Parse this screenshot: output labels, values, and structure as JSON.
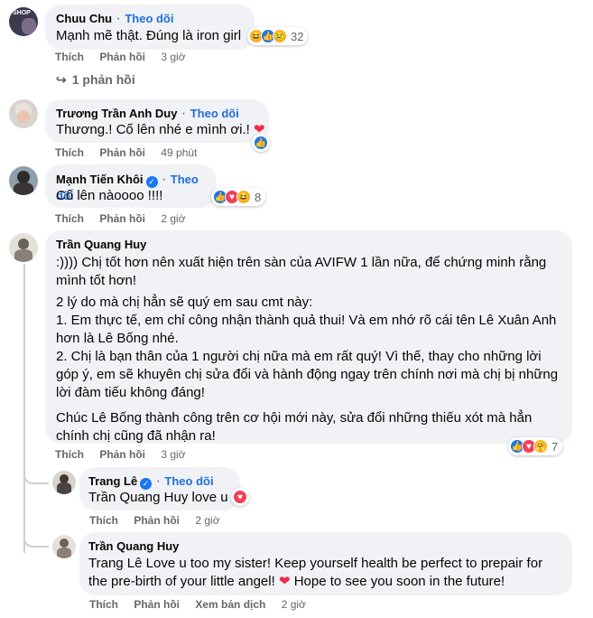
{
  "comments": [
    {
      "name": "Chuu Chu",
      "follow": "Theo dõi",
      "text": "Mạnh mẽ thật. Đúng là iron girl",
      "reactions": [
        "haha",
        "like",
        "sad"
      ],
      "reaction_count": "32",
      "like_label": "Thích",
      "reply_label": "Phản hồi",
      "time": "3 giờ",
      "replies_link": "1 phản hồi",
      "avatar_badge": "SHOP"
    },
    {
      "name": "Trương Trần Anh Duy",
      "follow": "Theo dõi",
      "text": "Thương.! Cố lên nhé e mình ơi.!",
      "reactions": [
        "like"
      ],
      "like_label": "Thích",
      "reply_label": "Phản hồi",
      "time": "49 phút"
    },
    {
      "name": "Mạnh Tiến Khôi",
      "follow": "Theo dõi",
      "text": "Cố lên nàoooo !!!!",
      "reactions": [
        "like",
        "love",
        "haha"
      ],
      "reaction_count": "8",
      "like_label": "Thích",
      "reply_label": "Phản hồi",
      "time": "2 giờ"
    },
    {
      "name": "Trần Quang Huy",
      "paragraphs": [
        ":)))) Chị tốt hơn nên xuất hiện trên sàn của AVIFW 1 lần nữa, để chứng minh rằng mình tốt hơn!",
        "2 lý do mà chị hẳn sẽ quý em sau cmt này:",
        "1. Em thực tế, em chỉ công nhận thành quả thui! Và em nhớ rõ cái tên Lê Xuân Anh hơn là Lê Bống nhé.",
        "2. Chị là bạn thân của 1 người chị nữa mà em rất quý! Vì thế, thay cho những lời góp ý, em sẽ khuyên chị sửa đổi và hành động ngay trên chính nơi mà chị bị những lời đàm tiếu không đáng!",
        "Chúc Lê Bống thành công trên cơ hội mới này, sửa đổi những thiếu xót mà hẳn chính chị cũng đã nhận ra!"
      ],
      "reactions": [
        "like",
        "love",
        "care"
      ],
      "reaction_count": "7",
      "like_label": "Thích",
      "reply_label": "Phản hồi",
      "time": "3 giờ"
    }
  ],
  "replies": [
    {
      "name": "Trang Lê",
      "follow": "Theo dõi",
      "mention": "Trần Quang Huy",
      "text": "love u",
      "reactions": [
        "love"
      ],
      "like_label": "Thích",
      "reply_label": "Phản hồi",
      "time": "2 giờ"
    },
    {
      "name": "Trần Quang Huy",
      "mention": "Trang Lê",
      "text": "Love u too my sister! Keep yourself health be perfect to prepair for the pre-birth of your little angel!",
      "text2": "Hope to see you soon in the future!",
      "like_label": "Thích",
      "reply_label": "Phản hồi",
      "translate_label": "Xem bản dịch",
      "time": "2 giờ"
    }
  ],
  "colors": {
    "link": "#216fdb",
    "bubble": "#f0f2f5",
    "muted": "#65676b",
    "like": "#1877f2",
    "love": "#f33e58"
  },
  "icons": {
    "reply_arrow": "reply-arrow-icon",
    "verified": "verified-badge-icon"
  }
}
